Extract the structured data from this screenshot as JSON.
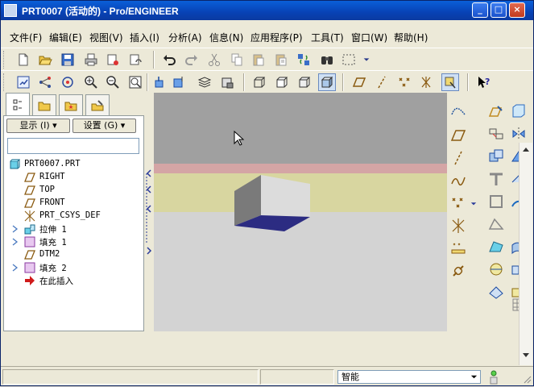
{
  "window": {
    "title": "PRT0007 (活动的) - Pro/ENGINEER",
    "minimize_label": "_",
    "maximize_label": "□",
    "close_label": "×"
  },
  "menu": [
    {
      "label": "文件(F)"
    },
    {
      "label": "编辑(E)"
    },
    {
      "label": "视图(V)"
    },
    {
      "label": "插入(I)"
    },
    {
      "label": "分析(A)"
    },
    {
      "label": "信息(N)"
    },
    {
      "label": "应用程序(P)"
    },
    {
      "label": "工具(T)"
    },
    {
      "label": "窗口(W)"
    },
    {
      "label": "帮助(H)"
    }
  ],
  "panel": {
    "show_label": "显示 (I) ▾",
    "settings_label": "设置 (G) ▾",
    "filter_value": ""
  },
  "tree": {
    "root": "PRT0007.PRT",
    "items": [
      {
        "label": "RIGHT",
        "icon": "datum-plane-icon",
        "expandable": false
      },
      {
        "label": "TOP",
        "icon": "datum-plane-icon",
        "expandable": false
      },
      {
        "label": "FRONT",
        "icon": "datum-plane-icon",
        "expandable": false
      },
      {
        "label": "PRT_CSYS_DEF",
        "icon": "csys-icon",
        "expandable": false
      },
      {
        "label": "拉伸 1",
        "icon": "extrude-icon",
        "expandable": true
      },
      {
        "label": "填充 1",
        "icon": "fill-icon",
        "expandable": true
      },
      {
        "label": "DTM2",
        "icon": "datum-plane-icon",
        "expandable": false
      },
      {
        "label": "填充 2",
        "icon": "fill-icon",
        "expandable": true
      },
      {
        "label": "在此插入",
        "icon": "insert-here-arrow-icon",
        "expandable": false
      }
    ]
  },
  "status": {
    "filter_value": "智能"
  },
  "colors": {
    "title_bar": "#0a4fcf",
    "graphics_bg": "#d3d3d3",
    "plane_pink": "#d4a5a5",
    "plane_yellow": "#d8d6a0",
    "surface_dark_blue": "#2a2a80"
  }
}
